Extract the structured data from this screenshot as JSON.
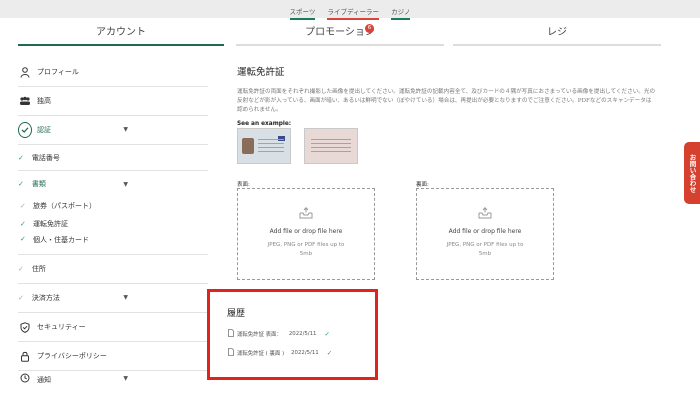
{
  "topnav": {
    "items": [
      "スポーツ",
      "ライブディーラー",
      "カジノ"
    ]
  },
  "tabs": {
    "account": "アカウント",
    "promotion": "プロモーション",
    "promotion_badge": "6",
    "register": "レジ"
  },
  "sidebar": {
    "profile": "プロフィール",
    "affiliate": "独高",
    "verification": "認証",
    "phone": "電話番号",
    "documents": "書類",
    "passport": "旅券（パスポート）",
    "drivers_license": "運転免許証",
    "id_card": "個人・住基カード",
    "address": "住所",
    "payment_method": "決済方法",
    "security": "セキュリティー",
    "privacy_policy": "プライバシーポリシー",
    "more": "通知"
  },
  "content": {
    "title": "運転免許証",
    "description": "運転免許証の両面をそれぞれ撮影した画像を提出してください。運転免許証の記載内容全て、及びカードの４隅が写真におさまっている画像を提出してください。光の反射などが影が入っている、画面が暗い、あるいは鮮明でない（ぼやけている）場合は、再提出が必要となりますのでご注意ください。PDFなどのスキャンデータは認められません。",
    "example_label": "See an example:",
    "front_label": "表面:",
    "back_label": "裏面:",
    "dropzone_add": "Add file or drop file here",
    "dropzone_formats": "JPEG, PNG or PDF files up to 5mb"
  },
  "history": {
    "title": "履歴",
    "rows": [
      {
        "name": "運転免許証 表面：",
        "date": "2022/5/11"
      },
      {
        "name": "運転免許証 ( 裏面 )",
        "date": "2022/5/11"
      }
    ]
  },
  "contact": {
    "label": "お問い合わせ"
  },
  "colors": {
    "accent": "#1f6a52",
    "highlight": "#e0231d",
    "contact_bg": "#d6402f",
    "check": "#2a9d6a"
  }
}
